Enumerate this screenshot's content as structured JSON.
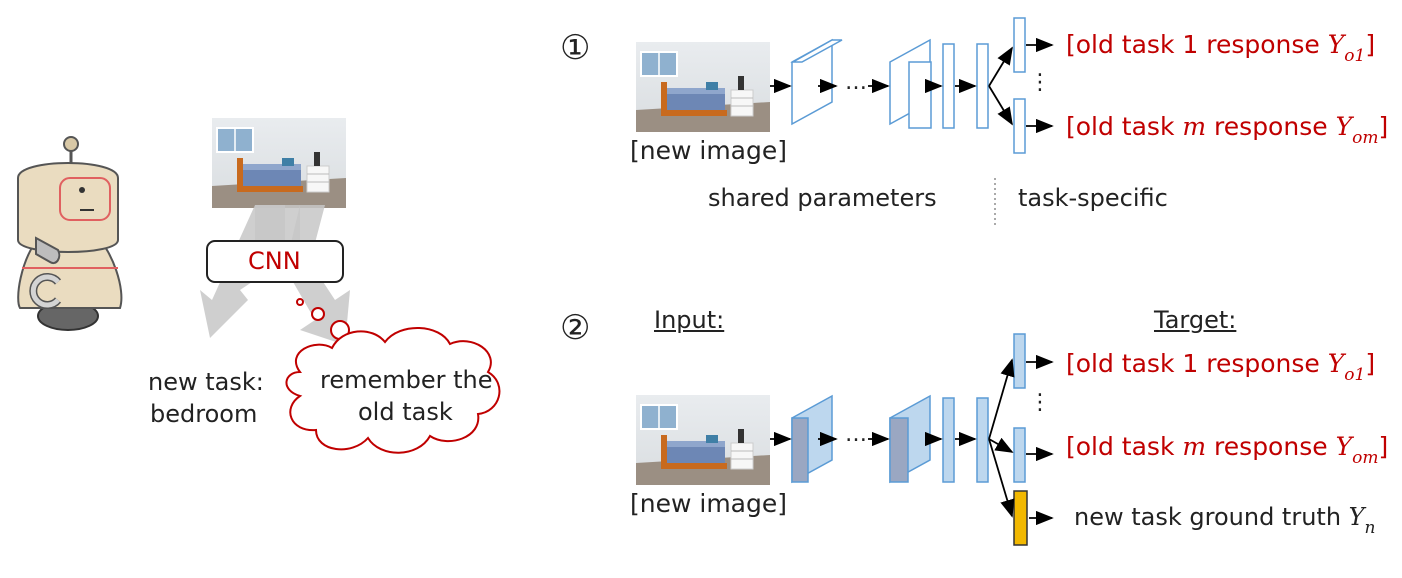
{
  "robot": {
    "cnn_label": "CNN",
    "new_task": [
      "new task:",
      "bedroom"
    ],
    "thought": [
      "remember the",
      "old task"
    ]
  },
  "panel1": {
    "marker": "①",
    "image_caption": "[new image]",
    "ellipsis": "…",
    "outputs": [
      {
        "prefix": "[old task ",
        "var": "1",
        "middle": " response ",
        "sym": "Y",
        "sub": "o1",
        "suffix": "]"
      },
      {
        "prefix": "[old task ",
        "var": "m",
        "middle": " response ",
        "sym": "Y",
        "sub": "om",
        "suffix": "]"
      }
    ],
    "vdots": "⋮",
    "shared_label": "shared parameters",
    "specific_label": "task-specific"
  },
  "panel2": {
    "marker": "②",
    "input_label": "Input:",
    "target_label": "Target:",
    "image_caption": "[new image]",
    "ellipsis": "…",
    "outputs": [
      {
        "prefix": "[old task ",
        "var": "1",
        "middle": " response ",
        "sym": "Y",
        "sub": "o1",
        "suffix": "]"
      },
      {
        "prefix": "[old task ",
        "var": "m",
        "middle": " response ",
        "sym": "Y",
        "sub": "om",
        "suffix": "]"
      }
    ],
    "vdots": "⋮",
    "new_task_label": "new task ground truth ",
    "new_task_sym": "Y",
    "new_task_sub": "n"
  },
  "colors": {
    "red": "#c00000",
    "layer_stroke": "#5b9bd5",
    "layer_fill": "#bdd7ee",
    "new_output": "#f2b800"
  }
}
